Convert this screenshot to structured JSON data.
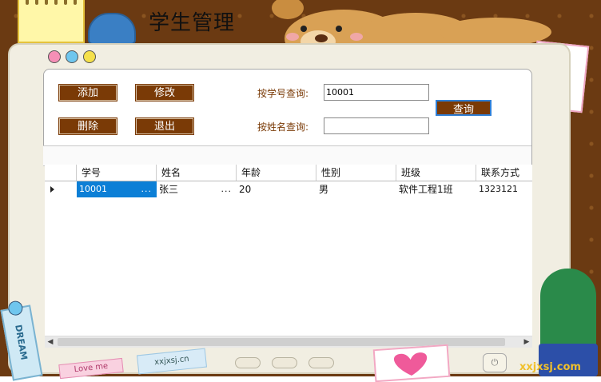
{
  "window": {
    "title": "学生管理"
  },
  "toolbar": {
    "add_label": "添加",
    "edit_label": "修改",
    "delete_label": "删除",
    "exit_label": "退出",
    "query_label": "查询"
  },
  "search": {
    "by_id_label": "按学号查询:",
    "by_id_value": "10001",
    "by_name_label": "按姓名查询:",
    "by_name_value": ""
  },
  "table": {
    "columns": [
      "学号",
      "姓名",
      "年龄",
      "性别",
      "班级",
      "联系方式"
    ],
    "rows": [
      [
        "10001",
        "张三",
        "20",
        "男",
        "软件工程1班",
        "1323121"
      ]
    ],
    "cell_ellipsis": "..."
  },
  "decor": {
    "dream_text": "DREAM",
    "tag_text": "xxjxsj.cn",
    "watermark": "xxjxsj.com",
    "love_text": "Love me"
  },
  "colors": {
    "button_brown": "#7a3a06",
    "selection_blue": "#0c7fd6",
    "label_brown": "#7a3a06"
  }
}
